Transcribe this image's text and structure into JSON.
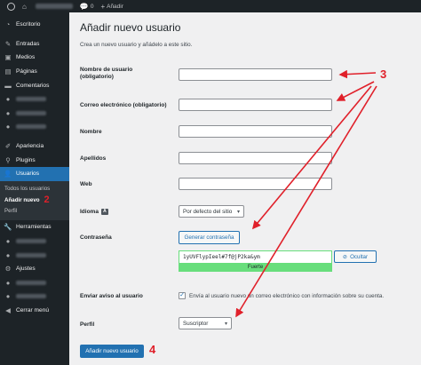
{
  "adminbar": {
    "comments_count": "0",
    "new_label": "Añadir"
  },
  "sidebar": {
    "items": [
      {
        "label": "Escritorio",
        "icon": "dashboard-icon"
      },
      {
        "label": "Entradas",
        "icon": "pin-icon"
      },
      {
        "label": "Medios",
        "icon": "media-icon"
      },
      {
        "label": "Páginas",
        "icon": "pages-icon"
      },
      {
        "label": "Comentarios",
        "icon": "comment-icon"
      },
      {
        "label": "Apariencia",
        "icon": "brush-icon"
      },
      {
        "label": "Plugins",
        "icon": "plugin-icon"
      },
      {
        "label": "Usuarios",
        "icon": "users-icon"
      },
      {
        "label": "Herramientas",
        "icon": "wrench-icon"
      },
      {
        "label": "Ajustes",
        "icon": "settings-icon"
      },
      {
        "label": "Cerrar menú",
        "icon": "collapse-icon"
      }
    ],
    "submenu": [
      "Todos los usuarios",
      "Añadir nuevo",
      "Perfil"
    ],
    "submenu_marker": "2"
  },
  "page": {
    "title": "Añadir nuevo usuario",
    "description": "Crea un nuevo usuario y añádelo a este sitio."
  },
  "form": {
    "username_label": "Nombre de usuario",
    "username_required": "(obligatorio)",
    "email_label": "Correo electrónico (obligatorio)",
    "firstname_label": "Nombre",
    "lastname_label": "Apellidos",
    "web_label": "Web",
    "language_label": "Idioma",
    "language_value": "Por defecto del sitio",
    "password_label": "Contraseña",
    "generate_password_button": "Generar contraseña",
    "password_value": "1yUVFlypIeel#7f@jP2ka&ym",
    "password_strength": "Fuerte",
    "hide_button": "Ocultar",
    "notify_label": "Enviar aviso al usuario",
    "notify_text": "Envía al usuario nuevo un correo electrónico con información sobre su cuenta.",
    "role_label": "Perfil",
    "role_value": "Suscriptor",
    "submit_button": "Añadir nuevo usuario"
  },
  "markers": {
    "three": "3",
    "four": "4"
  },
  "colors": {
    "accent": "#2271b1",
    "annotation": "#e0202a",
    "strength": "#68de7c"
  }
}
